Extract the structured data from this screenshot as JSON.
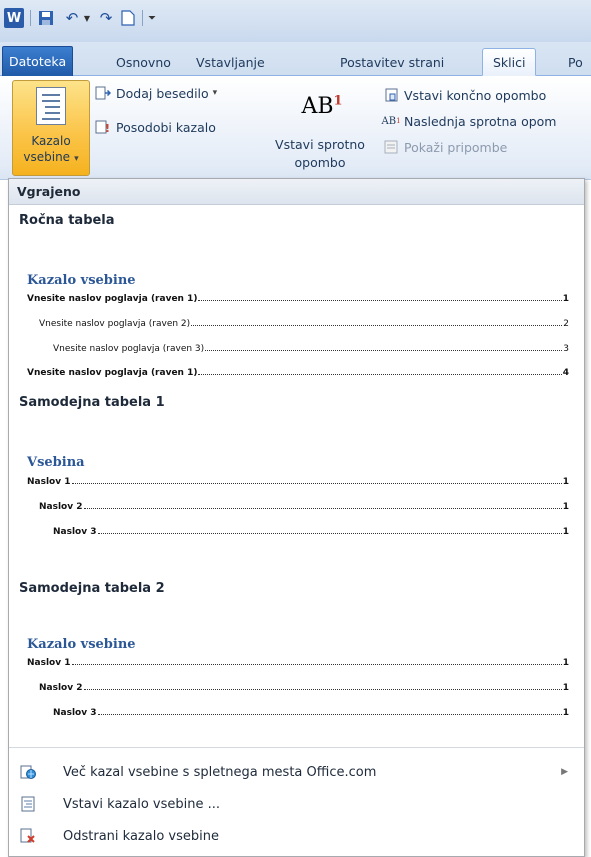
{
  "quick_access": {
    "app_icon_label": "W",
    "save_icon": "save-icon",
    "undo_icon": "undo-icon",
    "redo_icon": "redo-icon",
    "new_icon": "new-document-icon",
    "customize_icon": "customize-qat-icon"
  },
  "tabs": [
    {
      "label": "Datoteka"
    },
    {
      "label": "Osnovno"
    },
    {
      "label": "Vstavljanje"
    },
    {
      "label": "Postavitev strani"
    },
    {
      "label": "Sklici"
    },
    {
      "label": "Po"
    }
  ],
  "ribbon": {
    "toc_button_line1": "Kazalo",
    "toc_button_line2": "vsebine",
    "add_text": "Dodaj besedilo",
    "update_table": "Posodobi kazalo",
    "insert_footnote_glyph": "AB",
    "insert_footnote_sup": "1",
    "insert_footnote_line1": "Vstavi sprotno",
    "insert_footnote_line2": "opombo",
    "insert_endnote": "Vstavi končno opombo",
    "next_footnote": "Naslednja sprotna opom",
    "show_notes": "Pokaži pripombe"
  },
  "gallery": {
    "header": "Vgrajeno",
    "sections": [
      {
        "title": "Ročna tabela",
        "preview_title": "Kazalo vsebine",
        "lines": [
          {
            "text": "Vnesite naslov poglavja (raven 1)",
            "page": "1"
          },
          {
            "text": "Vnesite naslov poglavja (raven 2)",
            "page": "2"
          },
          {
            "text": "Vnesite naslov poglavja (raven 3)",
            "page": "3"
          },
          {
            "text": "Vnesite naslov poglavja (raven 1)",
            "page": "4"
          }
        ]
      },
      {
        "title": "Samodejna tabela 1",
        "preview_title": "Vsebina",
        "lines": [
          {
            "text": "Naslov 1",
            "page": "1"
          },
          {
            "text": "Naslov 2",
            "page": "1"
          },
          {
            "text": "Naslov 3",
            "page": "1"
          }
        ]
      },
      {
        "title": "Samodejna tabela 2",
        "preview_title": "Kazalo vsebine",
        "lines": [
          {
            "text": "Naslov 1",
            "page": "1"
          },
          {
            "text": "Naslov 2",
            "page": "1"
          },
          {
            "text": "Naslov 3",
            "page": "1"
          }
        ]
      }
    ],
    "menu": [
      {
        "label": "Več kazal vsebine s spletnega mesta Office.com"
      },
      {
        "label": "Vstavi kazalo vsebine ..."
      },
      {
        "label": "Odstrani kazalo vsebine"
      }
    ]
  }
}
